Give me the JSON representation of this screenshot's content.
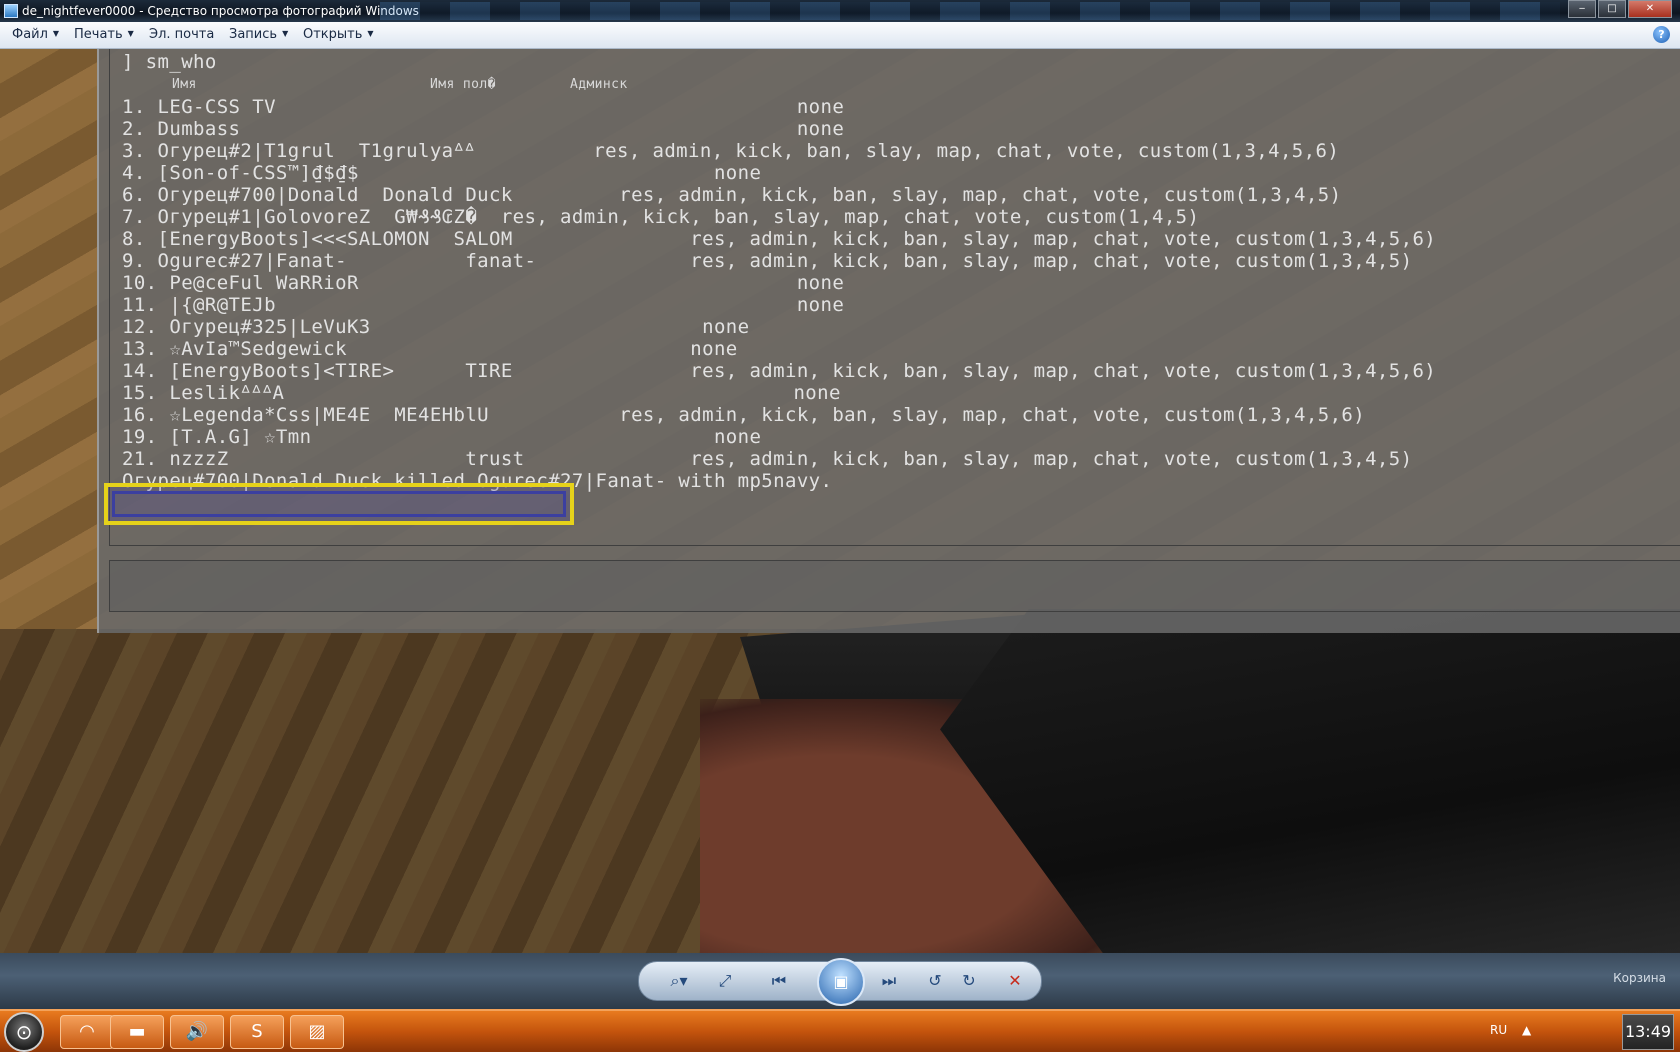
{
  "window": {
    "title": "de_nightfever0000 - Средство просмотра фотографий Windows",
    "minimize": "‒",
    "maximize": "□",
    "close": "✕"
  },
  "menu": {
    "items": [
      "Файл",
      "Печать",
      "Эл. почта",
      "Запись",
      "Открыть"
    ],
    "help": "?"
  },
  "console": {
    "command": "] sm_who",
    "headers": {
      "name": "Имя",
      "username": "Имя пол�",
      "access": "Админск"
    },
    "rows": [
      "1. LEG-CSS TV                                            none",
      "2. Dumbass                                               none",
      "3. Огурец#2|T1grul  T1grulyaᐞᐞ          res, admin, kick, ban, slay, map, chat, vote, custom(1,3,4,5,6)",
      "4. [Son-of-CSS™]₫$₫$                              none",
      "6. Огурец#700|Donald  Donald Duck         res, admin, kick, ban, slay, map, chat, vote, custom(1,3,4,5)",
      "7. Огурец#1|GolovoreZ  G₩₰₰₢Z�  res, admin, kick, ban, slay, map, chat, vote, custom(1,4,5)",
      "8. [EnergyBoots]<<<SALOMON  SALOM               res, admin, kick, ban, slay, map, chat, vote, custom(1,3,4,5,6)",
      "9. Ogurec#27|Fanat-          fanat-             res, admin, kick, ban, slay, map, chat, vote, custom(1,3,4,5)",
      "10. Pe@ceFul WaRRioR                                     none",
      "11. |{@R@TEJb                                            none",
      "12. Огурец#325|LeVuK3                            none",
      "13. ☆AvIa™Sedgewick                             none",
      "14. [EnergyBoots]<TIRE>      TIRE               res, admin, kick, ban, slay, map, chat, vote, custom(1,3,4,5,6)",
      "15. LeslikᐞᐞᐞA                                           none",
      "16. ☆Legenda*Css|ME4E  ME4EHblU           res, admin, kick, ban, slay, map, chat, vote, custom(1,3,4,5,6)",
      "19. [T.A.G] ☆Tmn                                  none",
      "21. nzzzZ                    trust              res, admin, kick, ban, slay, map, chat, vote, custom(1,3,4,5)"
    ],
    "kill_message": "Огурец#700|Donald Duck killed Ogurec#27|Fanat- with mp5navy."
  },
  "viewer_toolbar": {
    "zoom": "⌕▾",
    "fit": "⤢",
    "prev": "⏮",
    "slideshow": "▣",
    "next": "⏭",
    "rotate_ccw": "↺",
    "rotate_cw": "↻",
    "delete": "✕",
    "label": "Корзина"
  },
  "taskbar": {
    "start": "⊙",
    "items": [
      "◠",
      "▬",
      "🔊",
      "S",
      "▨"
    ],
    "lang": "RU",
    "tray_up": "▲",
    "clock": "13:49"
  },
  "colors": {
    "highlight_border": "#e6d21a",
    "highlight_inner": "#3b3fa0",
    "taskbar": "#c4540d"
  }
}
